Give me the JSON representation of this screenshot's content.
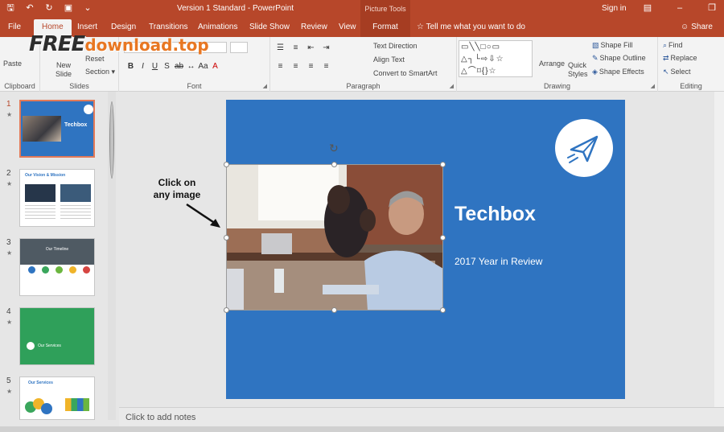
{
  "window": {
    "title": "Version 1 Standard  -  PowerPoint",
    "context_label": "Picture Tools",
    "signin": "Sign in",
    "share": "Share"
  },
  "tabs": [
    "File",
    "Home",
    "Insert",
    "Design",
    "Transitions",
    "Animations",
    "Slide Show",
    "Review",
    "View",
    "Format"
  ],
  "tell_me": "Tell me what you want to do",
  "watermark": {
    "brand": "FREE",
    "suffix": "download.top"
  },
  "ribbon": {
    "clipboard": {
      "paste": "Paste",
      "label": "Clipboard"
    },
    "slides": {
      "new_slide": "New Slide",
      "reset": "Reset",
      "section": "Section",
      "label": "Slides"
    },
    "font": {
      "label": "Font"
    },
    "paragraph": {
      "text_direction": "Text Direction",
      "align_text": "Align Text",
      "convert_smartart": "Convert to SmartArt",
      "label": "Paragraph"
    },
    "drawing": {
      "arrange": "Arrange",
      "quick_styles": "Quick Styles",
      "shape_fill": "Shape Fill",
      "shape_outline": "Shape Outline",
      "shape_effects": "Shape Effects",
      "label": "Drawing"
    },
    "editing": {
      "find": "Find",
      "replace": "Replace",
      "select": "Select",
      "label": "Editing"
    }
  },
  "thumbnails": [
    {
      "num": "1",
      "title": "Techbox",
      "selected": true
    },
    {
      "num": "2",
      "title": "Our Vision & Mission"
    },
    {
      "num": "3",
      "title": "Our Timeline"
    },
    {
      "num": "4",
      "title": "Our Services"
    },
    {
      "num": "5",
      "title": "Our Services"
    }
  ],
  "slide": {
    "title": "Techbox",
    "subtitle": "2017 Year in Review",
    "bg_color": "#2f74c1"
  },
  "annotation": {
    "line1": "Click on",
    "line2": "any image"
  },
  "notes_placeholder": "Click to add notes",
  "colors": {
    "accent": "#b7472a",
    "slide": "#2f74c1",
    "selected_thumb": "#e37a58"
  }
}
